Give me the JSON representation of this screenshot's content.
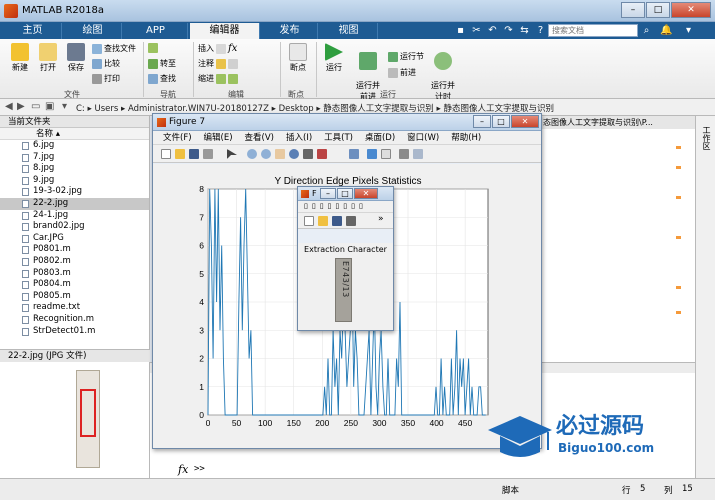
{
  "app": {
    "title": "MATLAB R2018a"
  },
  "tabs": [
    "主页",
    "绘图",
    "APP",
    "编辑器",
    "发布",
    "视图"
  ],
  "active_tab": "编辑器",
  "search": {
    "placeholder": "搜索文档"
  },
  "ribbon": {
    "file_group": {
      "label": "文件",
      "new": "新建",
      "open": "打开",
      "save": "保存",
      "find_files": "查找文件",
      "compare": "比较",
      "print": "打印"
    },
    "nav_group": {
      "label": "导航",
      "goto": "转至",
      "find": "查找"
    },
    "edit_group": {
      "label": "编辑",
      "insert": "插入",
      "comment": "注释",
      "indent": "缩进"
    },
    "breakpoints_group": {
      "label": "断点",
      "breakpoints": "断点"
    },
    "run_group": {
      "label": "运行",
      "run": "运行",
      "run_advance": "运行并\n前进",
      "run_section": "运行节",
      "advance": "前进",
      "run_time": "运行并\n计时"
    }
  },
  "address": {
    "path": [
      "C:",
      "Users",
      "Administrator.WIN7U-20180127Z",
      "Desktop",
      "静态图像人工文字提取与识别",
      "静态图像人工文字提取与识别"
    ],
    "right_path": "态图像人工文字提取与识别\\P..."
  },
  "left_panel": {
    "title": "当前文件夹",
    "column_name": "名称",
    "files": [
      "6.jpg",
      "7.jpg",
      "8.jpg",
      "9.jpg",
      "19-3-02.jpg",
      "22-2.jpg",
      "24-1.jpg",
      "brand02.jpg",
      "Car.JPG",
      "P0801.m",
      "P0802.m",
      "P0803.m",
      "P0804.m",
      "P0805.m",
      "readme.txt",
      "Recognition.m",
      "StrDetect01.m"
    ],
    "selected": "22-2.jpg",
    "detail": "22-2.jpg (JPG 文件)"
  },
  "right_bar": {
    "label": "工作区"
  },
  "command_window": {
    "fx_label": "fx",
    "prompt": ">>"
  },
  "status": {
    "script": "脚本",
    "row_label": "行",
    "row": "5",
    "col_label": "列",
    "col": "15"
  },
  "figure7": {
    "title": "Figure 7",
    "menu": [
      "文件(F)",
      "编辑(E)",
      "查看(V)",
      "插入(I)",
      "工具(T)",
      "桌面(D)",
      "窗口(W)",
      "帮助(H)"
    ]
  },
  "figure_small": {
    "title_prefix": "F",
    "caption": "Extraction Character",
    "plate_text": "E743/13"
  },
  "watermark": {
    "title": "必过源码",
    "url": "Biguo100.com"
  },
  "colors": {
    "line": "#1f77b4",
    "tab_bar": "#1e5b93",
    "brand": "#1e6ab8"
  },
  "chart_data": {
    "type": "line",
    "title": "Y Direction Edge Pixels Statistics",
    "xlim": [
      0,
      490
    ],
    "ylim": [
      0,
      8
    ],
    "xticks": [
      0,
      50,
      100,
      150,
      200,
      250,
      300,
      350,
      400,
      450
    ],
    "yticks": [
      0,
      1,
      2,
      3,
      4,
      5,
      6,
      7,
      8
    ],
    "grid": true,
    "series": [
      {
        "color": "#1f77b4",
        "x": [
          0,
          3,
          6,
          9,
          12,
          15,
          18,
          21,
          24,
          27,
          30,
          33,
          36,
          39,
          42,
          45,
          48,
          51,
          54,
          57,
          60,
          63,
          66,
          69,
          72,
          75,
          78,
          81,
          84,
          87,
          90,
          93,
          96,
          99,
          102,
          105,
          108,
          111,
          114,
          117,
          120,
          123,
          126,
          129,
          132,
          135,
          138,
          141,
          144,
          147,
          150,
          153,
          156,
          159,
          162,
          165,
          168,
          171,
          174,
          177,
          180,
          183,
          186,
          189,
          192,
          195,
          198,
          201,
          204,
          207,
          210,
          213,
          216,
          219,
          222,
          225,
          228,
          231,
          234,
          237,
          240,
          243,
          246,
          249,
          252,
          255,
          258,
          261,
          264,
          267,
          270,
          273,
          276,
          279,
          282,
          285,
          288,
          291,
          294,
          297,
          300,
          303,
          306,
          309,
          312,
          315,
          318,
          321,
          324,
          327,
          330,
          333,
          336,
          339,
          342,
          345,
          348,
          351,
          354,
          357,
          360,
          363,
          366,
          369,
          372,
          375,
          378,
          381,
          384,
          387,
          390,
          393,
          396,
          399,
          402,
          405,
          408,
          411,
          414,
          417,
          420,
          423,
          426,
          429,
          432,
          435,
          438,
          441,
          444,
          447,
          450,
          453,
          456,
          459,
          462,
          465,
          468,
          471,
          474,
          477,
          480,
          483,
          486
        ],
        "y": [
          0,
          8,
          6,
          2,
          8,
          4,
          8,
          3,
          6,
          2,
          0,
          0,
          0,
          0,
          0,
          0,
          0,
          0,
          4,
          7,
          3,
          6,
          8,
          5,
          2,
          3,
          0,
          0,
          0,
          0,
          0,
          0,
          0,
          0,
          0,
          0,
          0,
          0,
          0,
          0,
          0,
          0,
          0,
          0,
          0,
          0,
          0,
          0,
          0,
          0,
          0,
          0,
          0,
          0,
          0,
          0,
          0,
          0,
          0,
          0,
          0,
          0,
          0,
          0,
          0,
          0,
          0,
          0,
          1,
          0,
          2,
          0,
          0,
          3,
          1,
          2,
          0,
          3,
          2,
          4,
          3,
          1,
          2,
          3,
          5,
          1,
          3,
          2,
          0,
          0,
          0,
          0,
          1,
          2,
          3,
          0,
          2,
          4,
          1,
          0,
          2,
          3,
          1,
          0,
          0,
          2,
          0,
          0,
          0,
          0,
          2,
          1,
          4,
          0,
          0,
          0,
          0,
          0,
          0,
          0,
          0,
          0,
          0,
          0,
          0,
          0,
          0,
          0,
          0,
          0,
          0,
          0,
          0,
          1,
          0,
          0,
          2,
          0,
          1,
          0,
          0,
          0,
          2,
          0,
          1,
          3,
          0,
          2,
          1,
          2,
          0,
          1,
          2,
          0,
          1,
          0,
          0,
          0,
          1,
          1,
          0,
          0,
          0
        ]
      }
    ]
  }
}
